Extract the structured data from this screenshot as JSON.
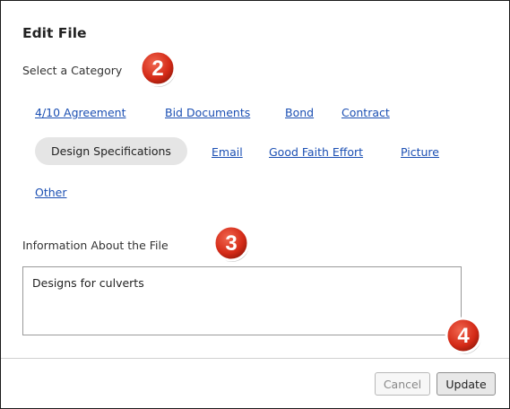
{
  "dialog": {
    "title": "Edit File",
    "category_label": "Select a Category",
    "categories": [
      {
        "label": "4/10 Agreement",
        "selected": false
      },
      {
        "label": "Bid Documents",
        "selected": false
      },
      {
        "label": "Bond",
        "selected": false
      },
      {
        "label": "Contract",
        "selected": false
      },
      {
        "label": "Design Specifications",
        "selected": true
      },
      {
        "label": "Email",
        "selected": false
      },
      {
        "label": "Good Faith Effort",
        "selected": false
      },
      {
        "label": "Picture",
        "selected": false
      },
      {
        "label": "Other",
        "selected": false
      }
    ],
    "info_label": "Information About the File",
    "info_value": "Designs for culverts",
    "cancel_label": "Cancel",
    "update_label": "Update"
  },
  "callouts": [
    "2",
    "3",
    "4"
  ],
  "colors": {
    "link": "#1b4fb3",
    "selected_pill": "#e5e5e5",
    "callout_red": "#d42a17"
  }
}
